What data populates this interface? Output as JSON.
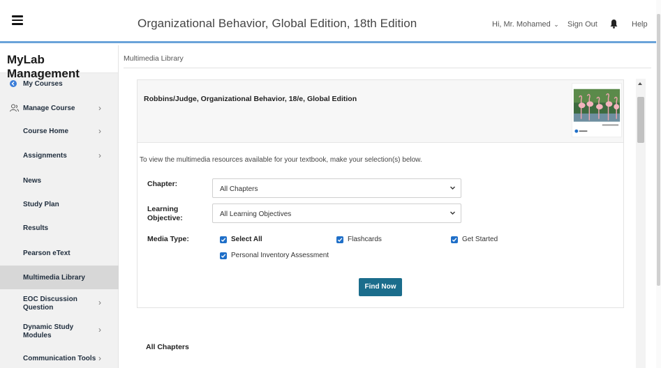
{
  "header": {
    "book_title": "Organizational Behavior, Global Edition, 18th Edition",
    "user_greeting": "Hi, Mr. Mohamed",
    "sign_out": "Sign Out",
    "help": "Help"
  },
  "sidebar": {
    "brand": "MyLab Management",
    "items": [
      {
        "label": "My Courses",
        "icon": "back-circle-icon",
        "arrow": false
      },
      {
        "label": "Manage Course",
        "icon": "users-icon",
        "arrow": true
      },
      {
        "label": "Course Home",
        "arrow": true
      },
      {
        "label": "Assignments",
        "arrow": true
      },
      {
        "label": "News",
        "arrow": false
      },
      {
        "label": "Study Plan",
        "arrow": false
      },
      {
        "label": "Results",
        "arrow": false
      },
      {
        "label": "Pearson eText",
        "arrow": false
      },
      {
        "label": "Multimedia Library",
        "arrow": false,
        "active": true
      },
      {
        "label": "EOC Discussion Question",
        "arrow": true
      },
      {
        "label": "Dynamic Study Modules",
        "arrow": true
      },
      {
        "label": "Communication Tools",
        "arrow": true
      }
    ]
  },
  "breadcrumb": "Multimedia Library",
  "panel": {
    "book_name": "Robbins/Judge, Organizational Behavior, 18/e, Global Edition",
    "intro": "To view the multimedia resources available for your textbook, make your selection(s) below.",
    "chapter_label": "Chapter:",
    "chapter_value": "All Chapters",
    "objective_label": "Learning Objective:",
    "objective_value": "All Learning Objectives",
    "media_label": "Media Type:",
    "media_options": [
      {
        "label": "Select All",
        "checked": true
      },
      {
        "label": "Flashcards",
        "checked": true
      },
      {
        "label": "Get Started",
        "checked": true
      },
      {
        "label": "Personal Inventory Assessment",
        "checked": true
      }
    ],
    "find_button": "Find Now"
  },
  "results_title": "All Chapters",
  "colors": {
    "accent_blue": "#6aa3d9",
    "checkbox_blue": "#1f6fc8",
    "button_teal": "#1b6d8c",
    "sidebar_active": "#d7d7d7"
  }
}
